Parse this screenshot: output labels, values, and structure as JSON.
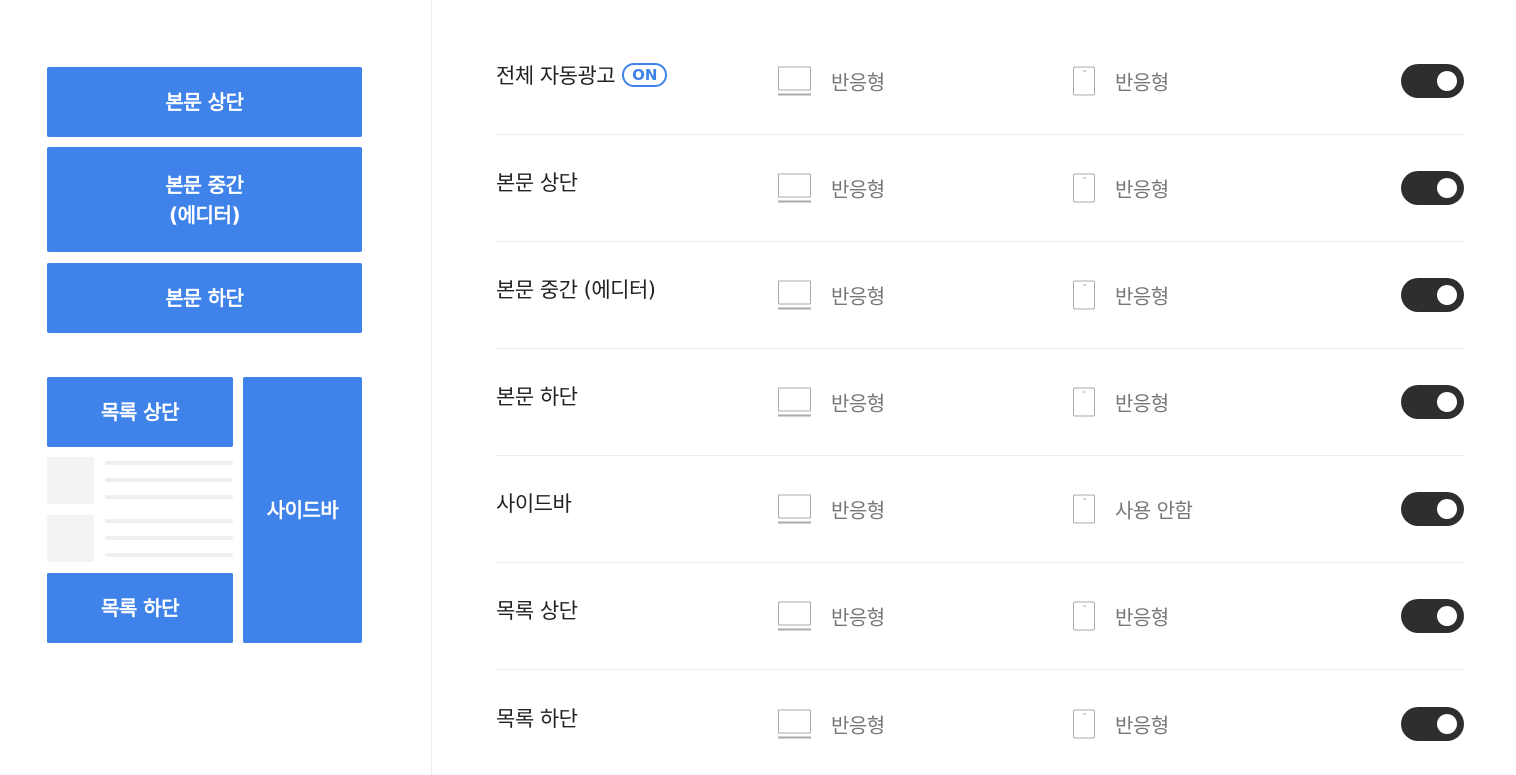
{
  "preview": {
    "top_label": "본문 상단",
    "middle_label": "본문 중간\n(에디터)",
    "bottom_label": "본문 하단",
    "list_top_label": "목록 상단",
    "list_bottom_label": "목록 하단",
    "sidebar_label": "사이드바"
  },
  "badge_on": "ON",
  "colors": {
    "accent": "#3f82ea",
    "toggle_on": "#2e2e2e",
    "divider": "#ececec",
    "placeholder": "#f3f3f3"
  },
  "rows": [
    {
      "label": "전체 자동광고",
      "badge": true,
      "pc_icon": "monitor-icon",
      "pc_value": "반응형",
      "mobile_icon": "mobile-icon",
      "mobile_value": "반응형",
      "enabled": true
    },
    {
      "label": "본문 상단",
      "badge": false,
      "pc_icon": "monitor-icon",
      "pc_value": "반응형",
      "mobile_icon": "mobile-icon",
      "mobile_value": "반응형",
      "enabled": true
    },
    {
      "label": "본문 중간 (에디터)",
      "badge": false,
      "pc_icon": "monitor-icon",
      "pc_value": "반응형",
      "mobile_icon": "mobile-icon",
      "mobile_value": "반응형",
      "enabled": true
    },
    {
      "label": "본문 하단",
      "badge": false,
      "pc_icon": "monitor-icon",
      "pc_value": "반응형",
      "mobile_icon": "mobile-icon",
      "mobile_value": "반응형",
      "enabled": true
    },
    {
      "label": "사이드바",
      "badge": false,
      "pc_icon": "monitor-icon",
      "pc_value": "반응형",
      "mobile_icon": "mobile-icon",
      "mobile_value": "사용 안함",
      "enabled": true
    },
    {
      "label": "목록 상단",
      "badge": false,
      "pc_icon": "monitor-icon",
      "pc_value": "반응형",
      "mobile_icon": "mobile-icon",
      "mobile_value": "반응형",
      "enabled": true
    },
    {
      "label": "목록 하단",
      "badge": false,
      "pc_icon": "monitor-icon",
      "pc_value": "반응형",
      "mobile_icon": "mobile-icon",
      "mobile_value": "반응형",
      "enabled": true
    }
  ]
}
